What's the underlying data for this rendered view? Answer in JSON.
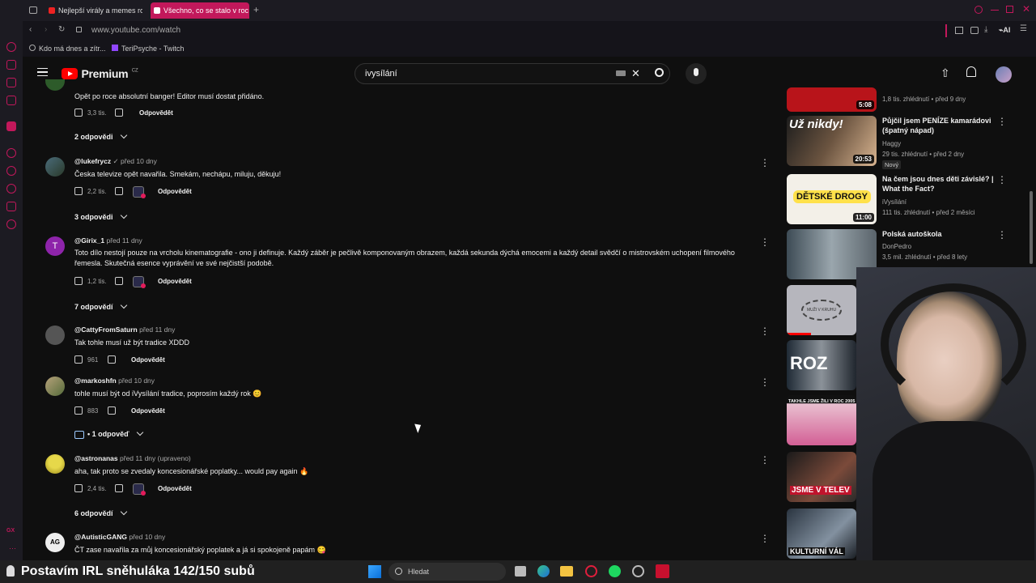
{
  "browser": {
    "tabs": [
      "Nejlepší virály a memes ro",
      "Všechno, co se stalo v roc"
    ],
    "url": "www.youtube.com/watch",
    "bookmarks": [
      "Kdo má dnes a zítr...",
      "TeriPsyche - Twitch"
    ],
    "ai_label": "AI"
  },
  "youtube": {
    "logo_text": "Premium",
    "region": "CZ",
    "search_value": "ivysílání"
  },
  "comments": [
    {
      "author": "",
      "ago": "",
      "text": "Opět po roce absolutní banger! Editor musí dostat přidáno.",
      "likes": "3,3 tis.",
      "reply": "Odpovědět",
      "replies": "2 odpovědi"
    },
    {
      "author": "@lukefrycz",
      "verified": "✓",
      "ago": "před 10 dny",
      "text": "Česka televize opět navařila. Smekám, nechápu, miluju, děkuju!",
      "likes": "2,2 tis.",
      "reply": "Odpovědět",
      "replies": "3 odpovědi"
    },
    {
      "author": "@Girix_1",
      "ago": "před 11 dny",
      "text": "Toto dílo nestojí pouze na vrcholu kinematografie - ono ji definuje. Každý záběr je pečlivě komponovaným obrazem, každá sekunda dýchá emocemi a každý detail svědčí o mistrovském uchopení filmového řemesla. Skutečná esence vyprávění ve své nejčistší podobě.",
      "likes": "1,2 tis.",
      "reply": "Odpovědět",
      "replies": "7 odpovědí",
      "avatar_letter": "T"
    },
    {
      "author": "@CattyFromSaturn",
      "ago": "před 11 dny",
      "text": "Tak tohle musí už být tradice XDDD",
      "likes": "961",
      "reply": "Odpovědět"
    },
    {
      "author": "@markoshfn",
      "ago": "před 10 dny",
      "text": "tohle musí být od iVysílání tradice, poprosím každý rok",
      "emoji": "😊",
      "likes": "883",
      "reply": "Odpovědět",
      "replies": "• 1 odpověď"
    },
    {
      "author": "@astronanas",
      "ago": "před 11 dny (upraveno)",
      "text": "aha, tak proto se zvedaly koncesionářské poplatky... would pay again",
      "emoji": "🔥",
      "likes": "2,4 tis.",
      "reply": "Odpovědět",
      "replies": "6 odpovědí"
    },
    {
      "author": "@AutisticGANG",
      "ago": "před 10 dny",
      "text": "ČT zase navařila za můj koncesionářský poplatek a já si spokojeně papám",
      "emoji": "😋"
    }
  ],
  "sidebar": [
    {
      "title": "",
      "channel": "",
      "meta": "1,8 tis. zhlédnutí • před 9 dny",
      "duration": "5:08",
      "color": "#b8141a"
    },
    {
      "title": "Půjčil jsem PENÍZE kamarádovi (špatný nápad)",
      "channel": "Haggy",
      "meta": "29 tis. zhlédnutí • před 2 dny",
      "duration": "20:53",
      "badge": "Nový",
      "thumb_text": "Už nikdy!",
      "color": "#5a4a3c"
    },
    {
      "title": "Na čem jsou dnes děti závislé? | What the Fact?",
      "channel": "iVysílání",
      "meta": "111 tis. zhlédnutí • před 2 měsíci",
      "duration": "11:00",
      "thumb_text": "DĚTSKÉ DROGY",
      "color": "#f3f0e8"
    },
    {
      "title": "Polská autoškola",
      "channel": "DonPedro",
      "meta": "3,5 mil. zhlédnutí • před 8 lety",
      "duration": "",
      "color": "#6f7d86"
    },
    {
      "title": "",
      "channel": "",
      "meta": "",
      "duration": "",
      "thumb_text": "MUŽI V KRUHU",
      "color": "#b6b6bd"
    },
    {
      "title": "",
      "channel": "",
      "meta": "",
      "duration": "",
      "thumb_text": "ROZ",
      "color": "#2e3946"
    },
    {
      "title": "",
      "channel": "",
      "meta": "",
      "duration": "",
      "thumb_text": "TAKHLE JSME ŽILI V ROC 2005",
      "color": "#d98fb0"
    },
    {
      "title": "",
      "channel": "",
      "meta": "",
      "duration": "",
      "thumb_text": "JSME V TELEV",
      "color": "#3a2a2a"
    },
    {
      "title": "",
      "channel": "",
      "meta": "",
      "duration": "",
      "thumb_text": "KULTURNÍ VÁL",
      "color": "#3c4a55"
    }
  ],
  "taskbar": {
    "stream_title": "Postavím IRL sněhuláka 142/150 subů",
    "search_placeholder": "Hledat"
  }
}
